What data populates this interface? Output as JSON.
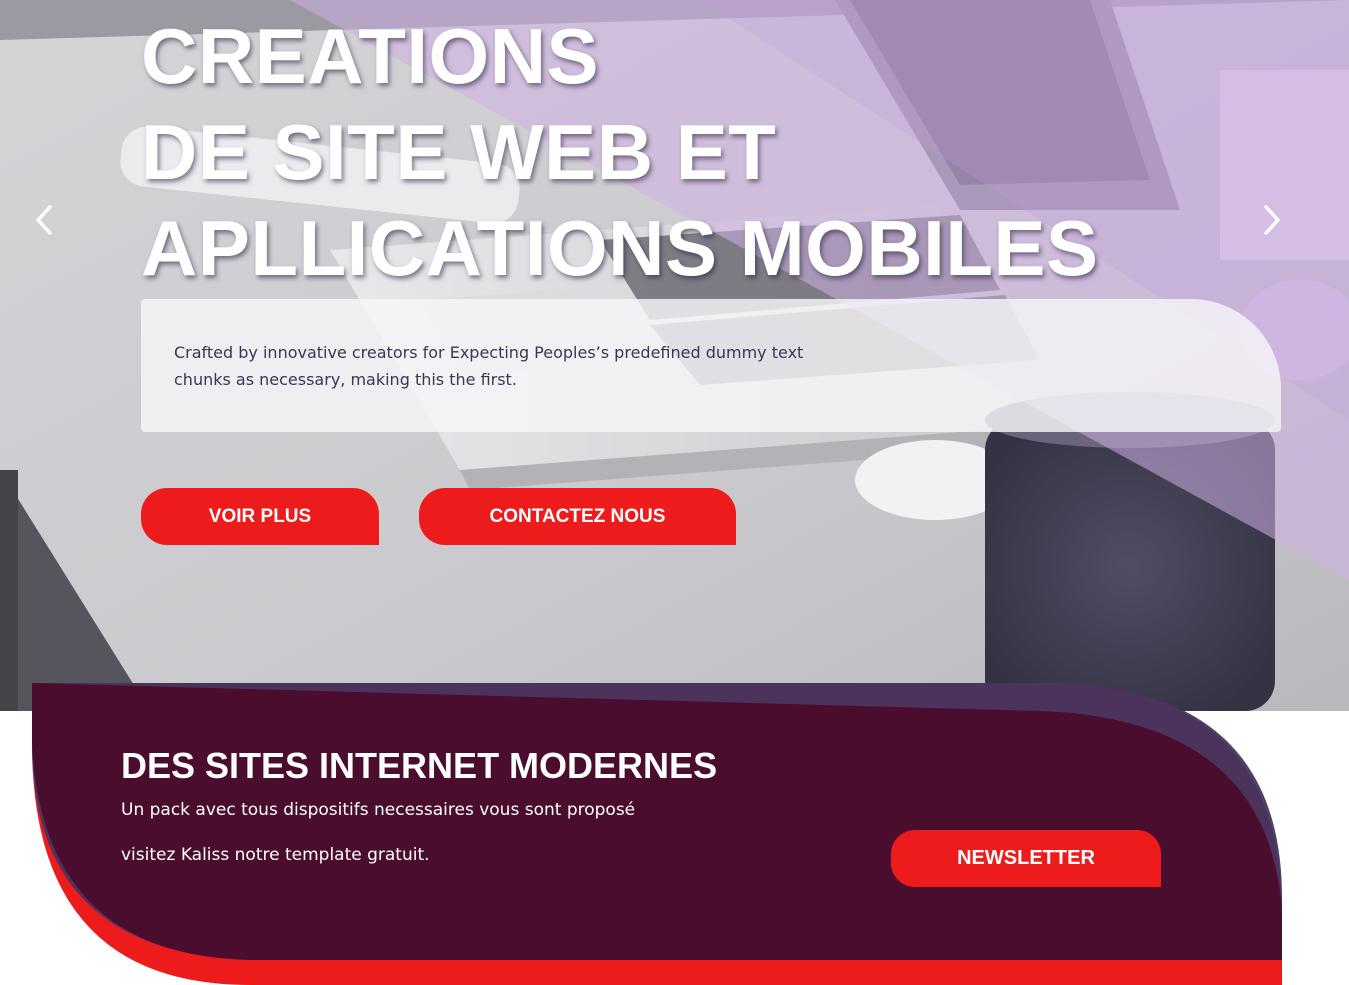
{
  "hero": {
    "title_lines": [
      "CREATIONS",
      "DE SITE WEB ET",
      "APLLICATIONS MOBILES"
    ],
    "description": "Crafted by innovative creators for Expecting Peoples’s predefined dummy text chunks as necessary, making this the first.",
    "buttons": {
      "primary_label": "VOIR PLUS",
      "secondary_label": "CONTACTEZ NOUS"
    },
    "carousel": {
      "prev_icon": "chevron-left-icon",
      "next_icon": "chevron-right-icon"
    }
  },
  "newsletter_band": {
    "title": "DES SITES INTERNET MODERNES",
    "line_1": "Un pack avec tous dispositifs necessaires vous sont proposé",
    "line_2": "visitez Kaliss notre template gratuit.",
    "button_label": "NEWSLETTER"
  },
  "colors": {
    "accent_red": "#ed1b1b",
    "band_dark": "#4a0d2e",
    "band_shadow": "#3f3560",
    "hero_tint": "#c8a6e0"
  }
}
